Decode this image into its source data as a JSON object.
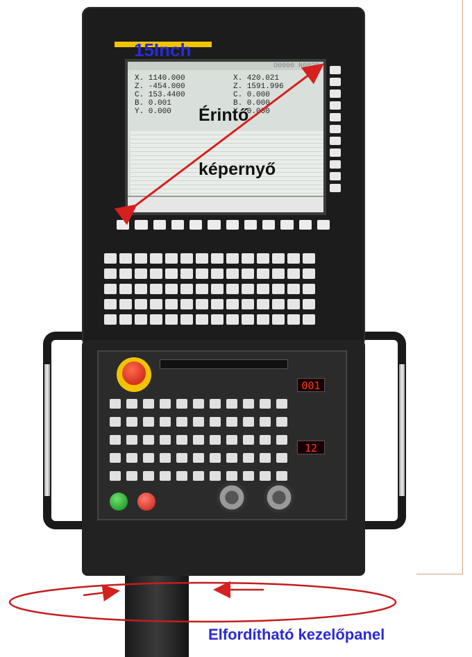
{
  "annotations": {
    "screen_size": "15Inch",
    "touch_line1": "Érintő",
    "touch_line2": "képernyő",
    "rotation": "Elfordítható kezelőpanel"
  },
  "screen_readout": {
    "left": [
      "X. 1140.000",
      "Z. -454.000",
      "C. 153.4400",
      "B.  0.001",
      "Y.  0.000"
    ],
    "right": [
      "X.  420.021",
      "Z. 1591.996",
      "C.   0.000",
      "B.   0.000",
      "Y.   0.000"
    ],
    "corner_code": "O0000 N0029"
  },
  "displays": {
    "upper": "001",
    "lower": "12"
  },
  "colors": {
    "arrow": "#d61f1f",
    "label_blue": "#2a2ad8",
    "panel": "#1c1c1c"
  }
}
